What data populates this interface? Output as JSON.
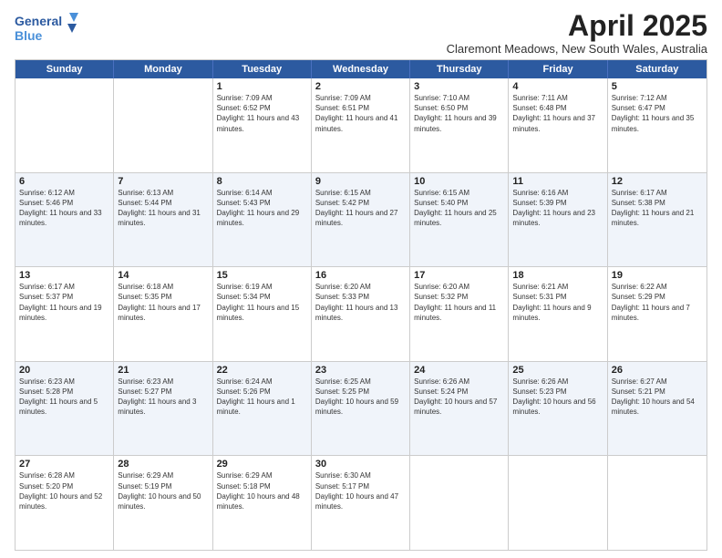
{
  "logo": {
    "line1": "General",
    "line2": "Blue"
  },
  "title": "April 2025",
  "subtitle": "Claremont Meadows, New South Wales, Australia",
  "days_of_week": [
    "Sunday",
    "Monday",
    "Tuesday",
    "Wednesday",
    "Thursday",
    "Friday",
    "Saturday"
  ],
  "weeks": [
    [
      {
        "day": "",
        "info": ""
      },
      {
        "day": "",
        "info": ""
      },
      {
        "day": "1",
        "info": "Sunrise: 7:09 AM\nSunset: 6:52 PM\nDaylight: 11 hours and 43 minutes."
      },
      {
        "day": "2",
        "info": "Sunrise: 7:09 AM\nSunset: 6:51 PM\nDaylight: 11 hours and 41 minutes."
      },
      {
        "day": "3",
        "info": "Sunrise: 7:10 AM\nSunset: 6:50 PM\nDaylight: 11 hours and 39 minutes."
      },
      {
        "day": "4",
        "info": "Sunrise: 7:11 AM\nSunset: 6:48 PM\nDaylight: 11 hours and 37 minutes."
      },
      {
        "day": "5",
        "info": "Sunrise: 7:12 AM\nSunset: 6:47 PM\nDaylight: 11 hours and 35 minutes."
      }
    ],
    [
      {
        "day": "6",
        "info": "Sunrise: 6:12 AM\nSunset: 5:46 PM\nDaylight: 11 hours and 33 minutes."
      },
      {
        "day": "7",
        "info": "Sunrise: 6:13 AM\nSunset: 5:44 PM\nDaylight: 11 hours and 31 minutes."
      },
      {
        "day": "8",
        "info": "Sunrise: 6:14 AM\nSunset: 5:43 PM\nDaylight: 11 hours and 29 minutes."
      },
      {
        "day": "9",
        "info": "Sunrise: 6:15 AM\nSunset: 5:42 PM\nDaylight: 11 hours and 27 minutes."
      },
      {
        "day": "10",
        "info": "Sunrise: 6:15 AM\nSunset: 5:40 PM\nDaylight: 11 hours and 25 minutes."
      },
      {
        "day": "11",
        "info": "Sunrise: 6:16 AM\nSunset: 5:39 PM\nDaylight: 11 hours and 23 minutes."
      },
      {
        "day": "12",
        "info": "Sunrise: 6:17 AM\nSunset: 5:38 PM\nDaylight: 11 hours and 21 minutes."
      }
    ],
    [
      {
        "day": "13",
        "info": "Sunrise: 6:17 AM\nSunset: 5:37 PM\nDaylight: 11 hours and 19 minutes."
      },
      {
        "day": "14",
        "info": "Sunrise: 6:18 AM\nSunset: 5:35 PM\nDaylight: 11 hours and 17 minutes."
      },
      {
        "day": "15",
        "info": "Sunrise: 6:19 AM\nSunset: 5:34 PM\nDaylight: 11 hours and 15 minutes."
      },
      {
        "day": "16",
        "info": "Sunrise: 6:20 AM\nSunset: 5:33 PM\nDaylight: 11 hours and 13 minutes."
      },
      {
        "day": "17",
        "info": "Sunrise: 6:20 AM\nSunset: 5:32 PM\nDaylight: 11 hours and 11 minutes."
      },
      {
        "day": "18",
        "info": "Sunrise: 6:21 AM\nSunset: 5:31 PM\nDaylight: 11 hours and 9 minutes."
      },
      {
        "day": "19",
        "info": "Sunrise: 6:22 AM\nSunset: 5:29 PM\nDaylight: 11 hours and 7 minutes."
      }
    ],
    [
      {
        "day": "20",
        "info": "Sunrise: 6:23 AM\nSunset: 5:28 PM\nDaylight: 11 hours and 5 minutes."
      },
      {
        "day": "21",
        "info": "Sunrise: 6:23 AM\nSunset: 5:27 PM\nDaylight: 11 hours and 3 minutes."
      },
      {
        "day": "22",
        "info": "Sunrise: 6:24 AM\nSunset: 5:26 PM\nDaylight: 11 hours and 1 minute."
      },
      {
        "day": "23",
        "info": "Sunrise: 6:25 AM\nSunset: 5:25 PM\nDaylight: 10 hours and 59 minutes."
      },
      {
        "day": "24",
        "info": "Sunrise: 6:26 AM\nSunset: 5:24 PM\nDaylight: 10 hours and 57 minutes."
      },
      {
        "day": "25",
        "info": "Sunrise: 6:26 AM\nSunset: 5:23 PM\nDaylight: 10 hours and 56 minutes."
      },
      {
        "day": "26",
        "info": "Sunrise: 6:27 AM\nSunset: 5:21 PM\nDaylight: 10 hours and 54 minutes."
      }
    ],
    [
      {
        "day": "27",
        "info": "Sunrise: 6:28 AM\nSunset: 5:20 PM\nDaylight: 10 hours and 52 minutes."
      },
      {
        "day": "28",
        "info": "Sunrise: 6:29 AM\nSunset: 5:19 PM\nDaylight: 10 hours and 50 minutes."
      },
      {
        "day": "29",
        "info": "Sunrise: 6:29 AM\nSunset: 5:18 PM\nDaylight: 10 hours and 48 minutes."
      },
      {
        "day": "30",
        "info": "Sunrise: 6:30 AM\nSunset: 5:17 PM\nDaylight: 10 hours and 47 minutes."
      },
      {
        "day": "",
        "info": ""
      },
      {
        "day": "",
        "info": ""
      },
      {
        "day": "",
        "info": ""
      }
    ]
  ]
}
